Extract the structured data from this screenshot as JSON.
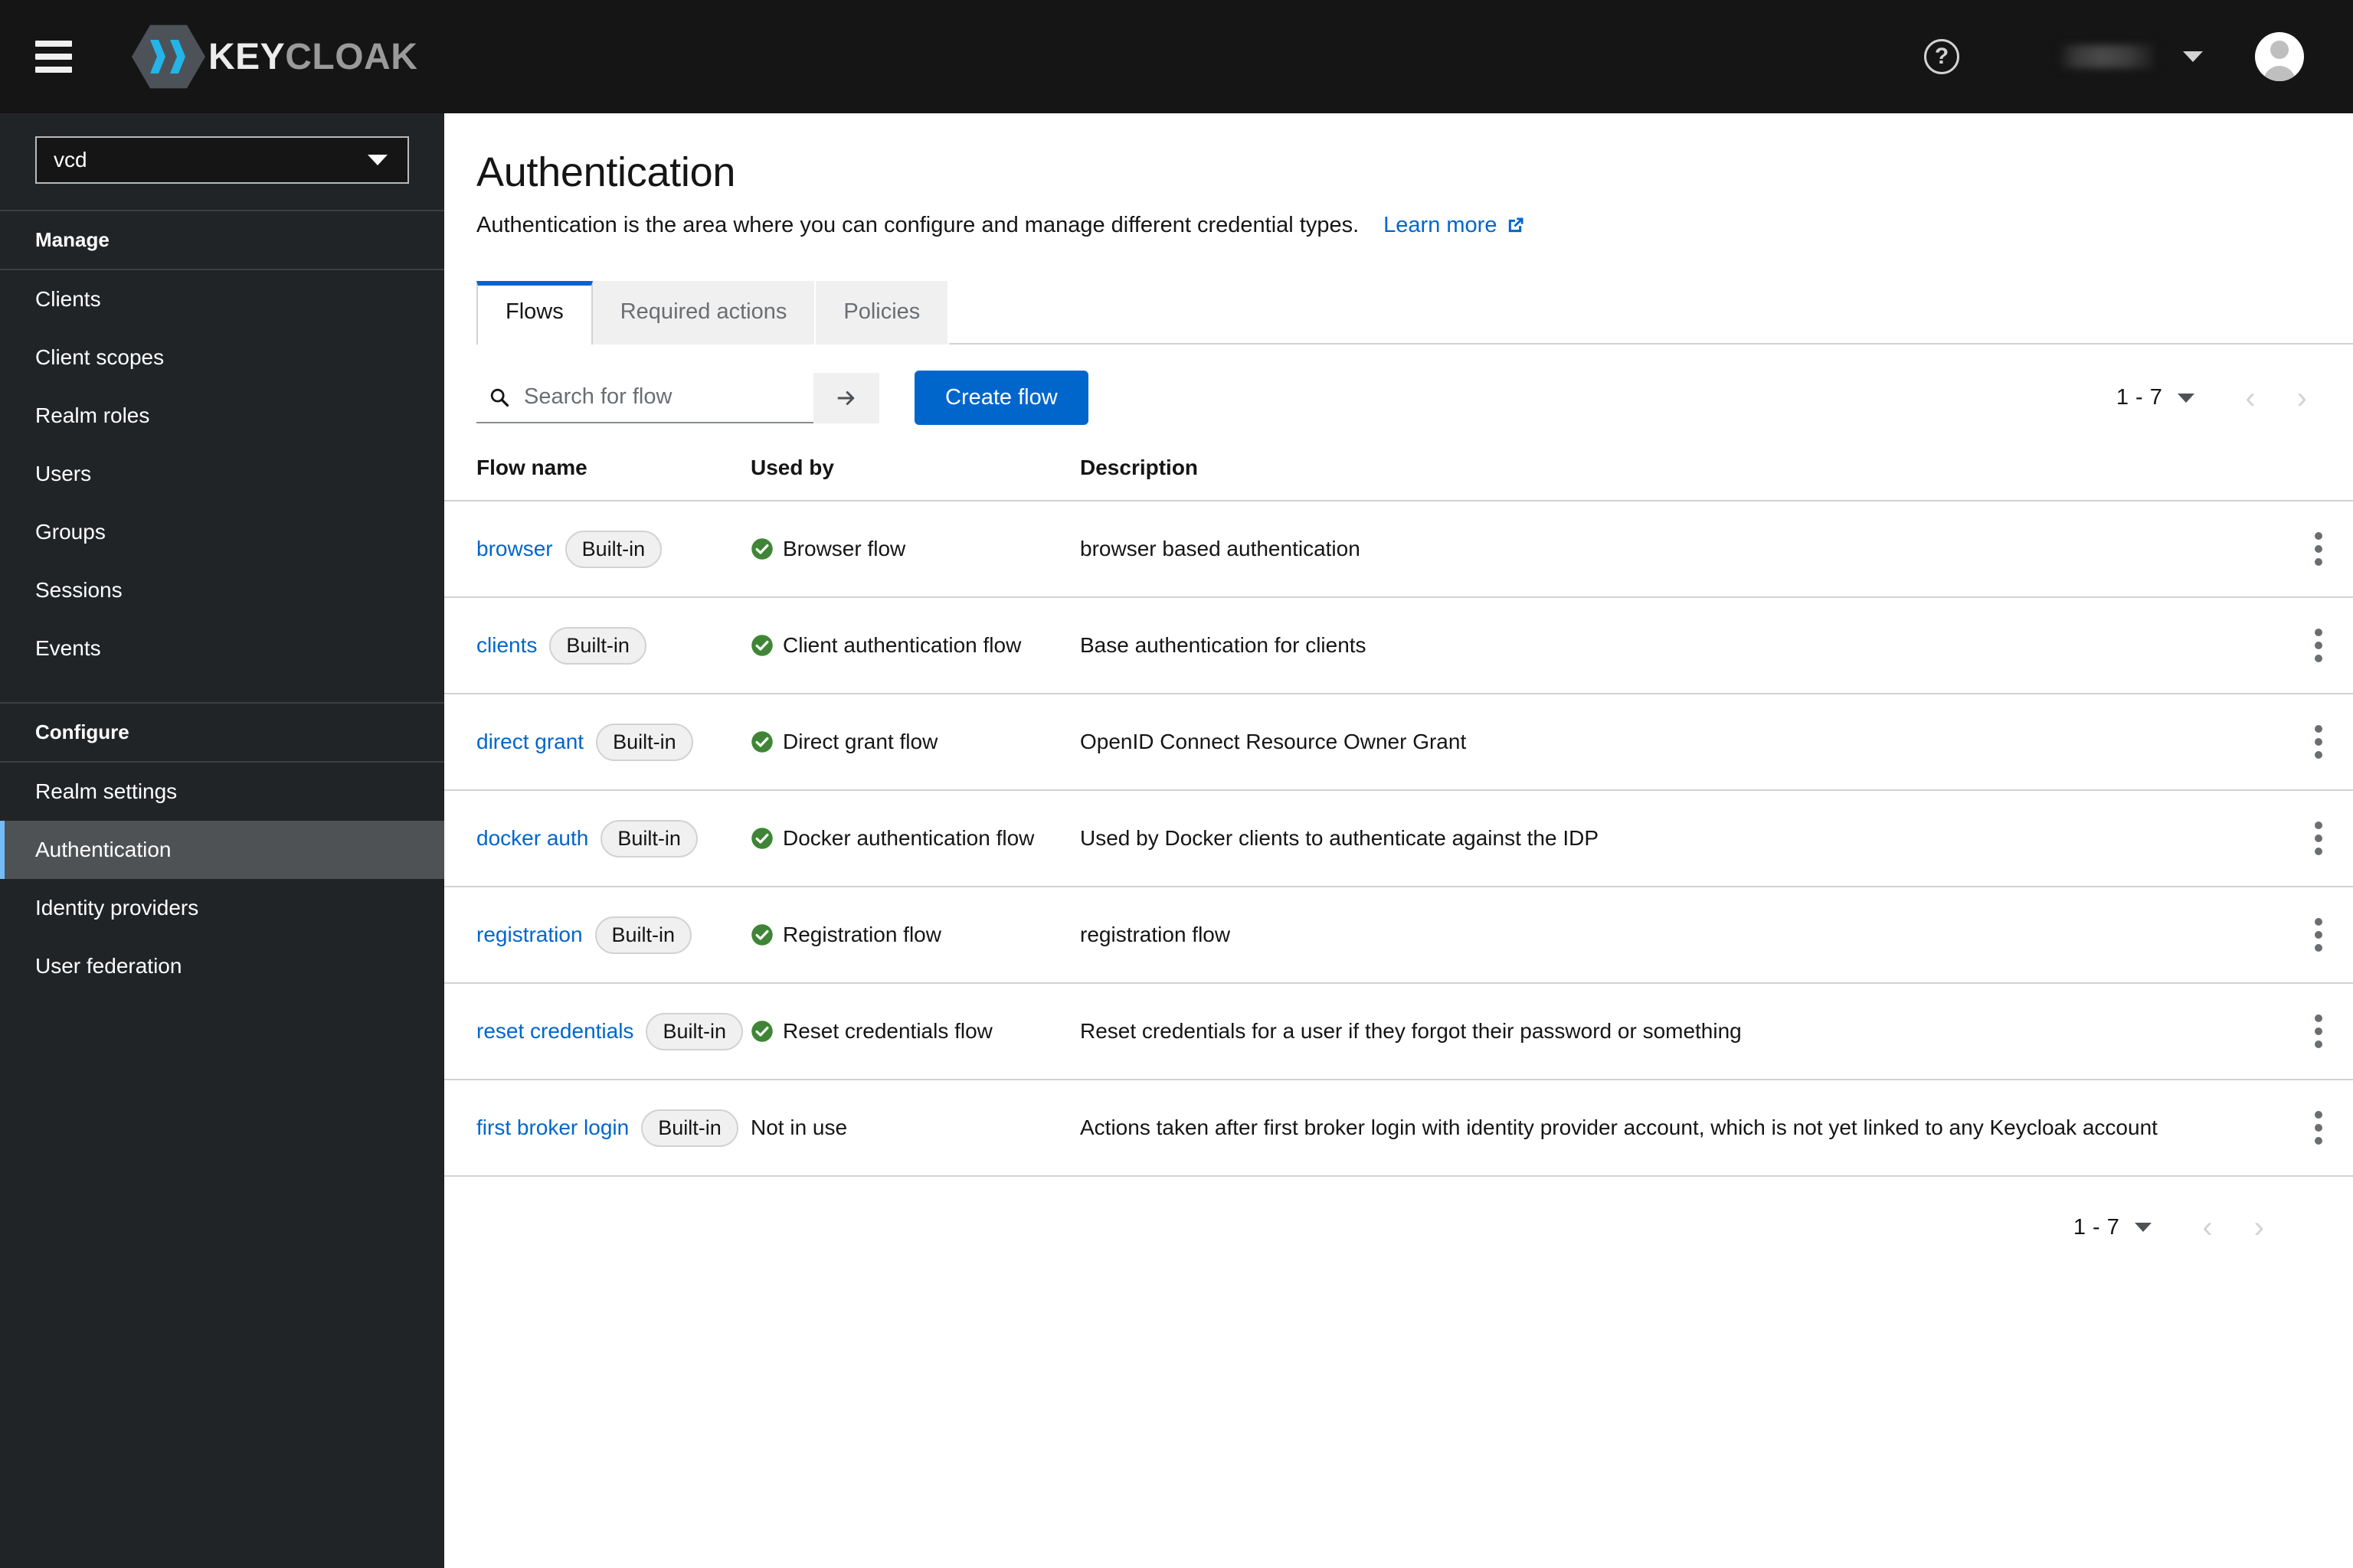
{
  "masthead": {
    "menu_icon": "hamburger-icon",
    "brand_prefix": "KEY",
    "brand_suffix": "CLOAK",
    "brand_full": "KEYCLOAK",
    "help_label": "?",
    "username": "",
    "avatar_label": "user-avatar"
  },
  "sidebar": {
    "realm": {
      "value": "vcd"
    },
    "groups": [
      {
        "title": "Manage",
        "items": [
          {
            "label": "Clients",
            "active": false
          },
          {
            "label": "Client scopes",
            "active": false
          },
          {
            "label": "Realm roles",
            "active": false
          },
          {
            "label": "Users",
            "active": false
          },
          {
            "label": "Groups",
            "active": false
          },
          {
            "label": "Sessions",
            "active": false
          },
          {
            "label": "Events",
            "active": false
          }
        ]
      },
      {
        "title": "Configure",
        "items": [
          {
            "label": "Realm settings",
            "active": false
          },
          {
            "label": "Authentication",
            "active": true
          },
          {
            "label": "Identity providers",
            "active": false
          },
          {
            "label": "User federation",
            "active": false
          }
        ]
      }
    ]
  },
  "page": {
    "title": "Authentication",
    "subtitle": "Authentication is the area where you can configure and manage different credential types.",
    "learn_more": "Learn more"
  },
  "tabs": [
    {
      "label": "Flows",
      "active": true
    },
    {
      "label": "Required actions",
      "active": false
    },
    {
      "label": "Policies",
      "active": false
    }
  ],
  "toolbar": {
    "search_placeholder": "Search for flow",
    "search_value": "",
    "search_submit_label": "search-arrow",
    "create_label": "Create flow"
  },
  "pagination": {
    "range": "1 - 7",
    "prev_label": "‹",
    "next_label": "›"
  },
  "table": {
    "columns": [
      "Flow name",
      "Used by",
      "Description"
    ],
    "rows": [
      {
        "name": "browser",
        "badge": "Built-in",
        "used_by": "Browser flow",
        "used_by_in_use": true,
        "description": "browser based authentication"
      },
      {
        "name": "clients",
        "badge": "Built-in",
        "used_by": "Client authentication flow",
        "used_by_in_use": true,
        "description": "Base authentication for clients"
      },
      {
        "name": "direct grant",
        "badge": "Built-in",
        "used_by": "Direct grant flow",
        "used_by_in_use": true,
        "description": "OpenID Connect Resource Owner Grant"
      },
      {
        "name": "docker auth",
        "badge": "Built-in",
        "used_by": "Docker authentication flow",
        "used_by_in_use": true,
        "description": "Used by Docker clients to authenticate against the IDP"
      },
      {
        "name": "registration",
        "badge": "Built-in",
        "used_by": "Registration flow",
        "used_by_in_use": true,
        "description": "registration flow"
      },
      {
        "name": "reset credentials",
        "badge": "Built-in",
        "used_by": "Reset credentials flow",
        "used_by_in_use": true,
        "description": "Reset credentials for a user if they forgot their password or something"
      },
      {
        "name": "first broker login",
        "badge": "Built-in",
        "used_by": "Not in use",
        "used_by_in_use": false,
        "description": "Actions taken after first broker login with identity provider account, which is not yet linked to any Keycloak account"
      }
    ]
  },
  "colors": {
    "accent_blue": "#0066cc",
    "masthead_bg": "#151515",
    "sidebar_bg": "#212427",
    "active_nav_bg": "#4f5255",
    "active_nav_border": "#73bcf7",
    "success_green": "#3e8635",
    "logo_blue": "#23b4e8"
  }
}
